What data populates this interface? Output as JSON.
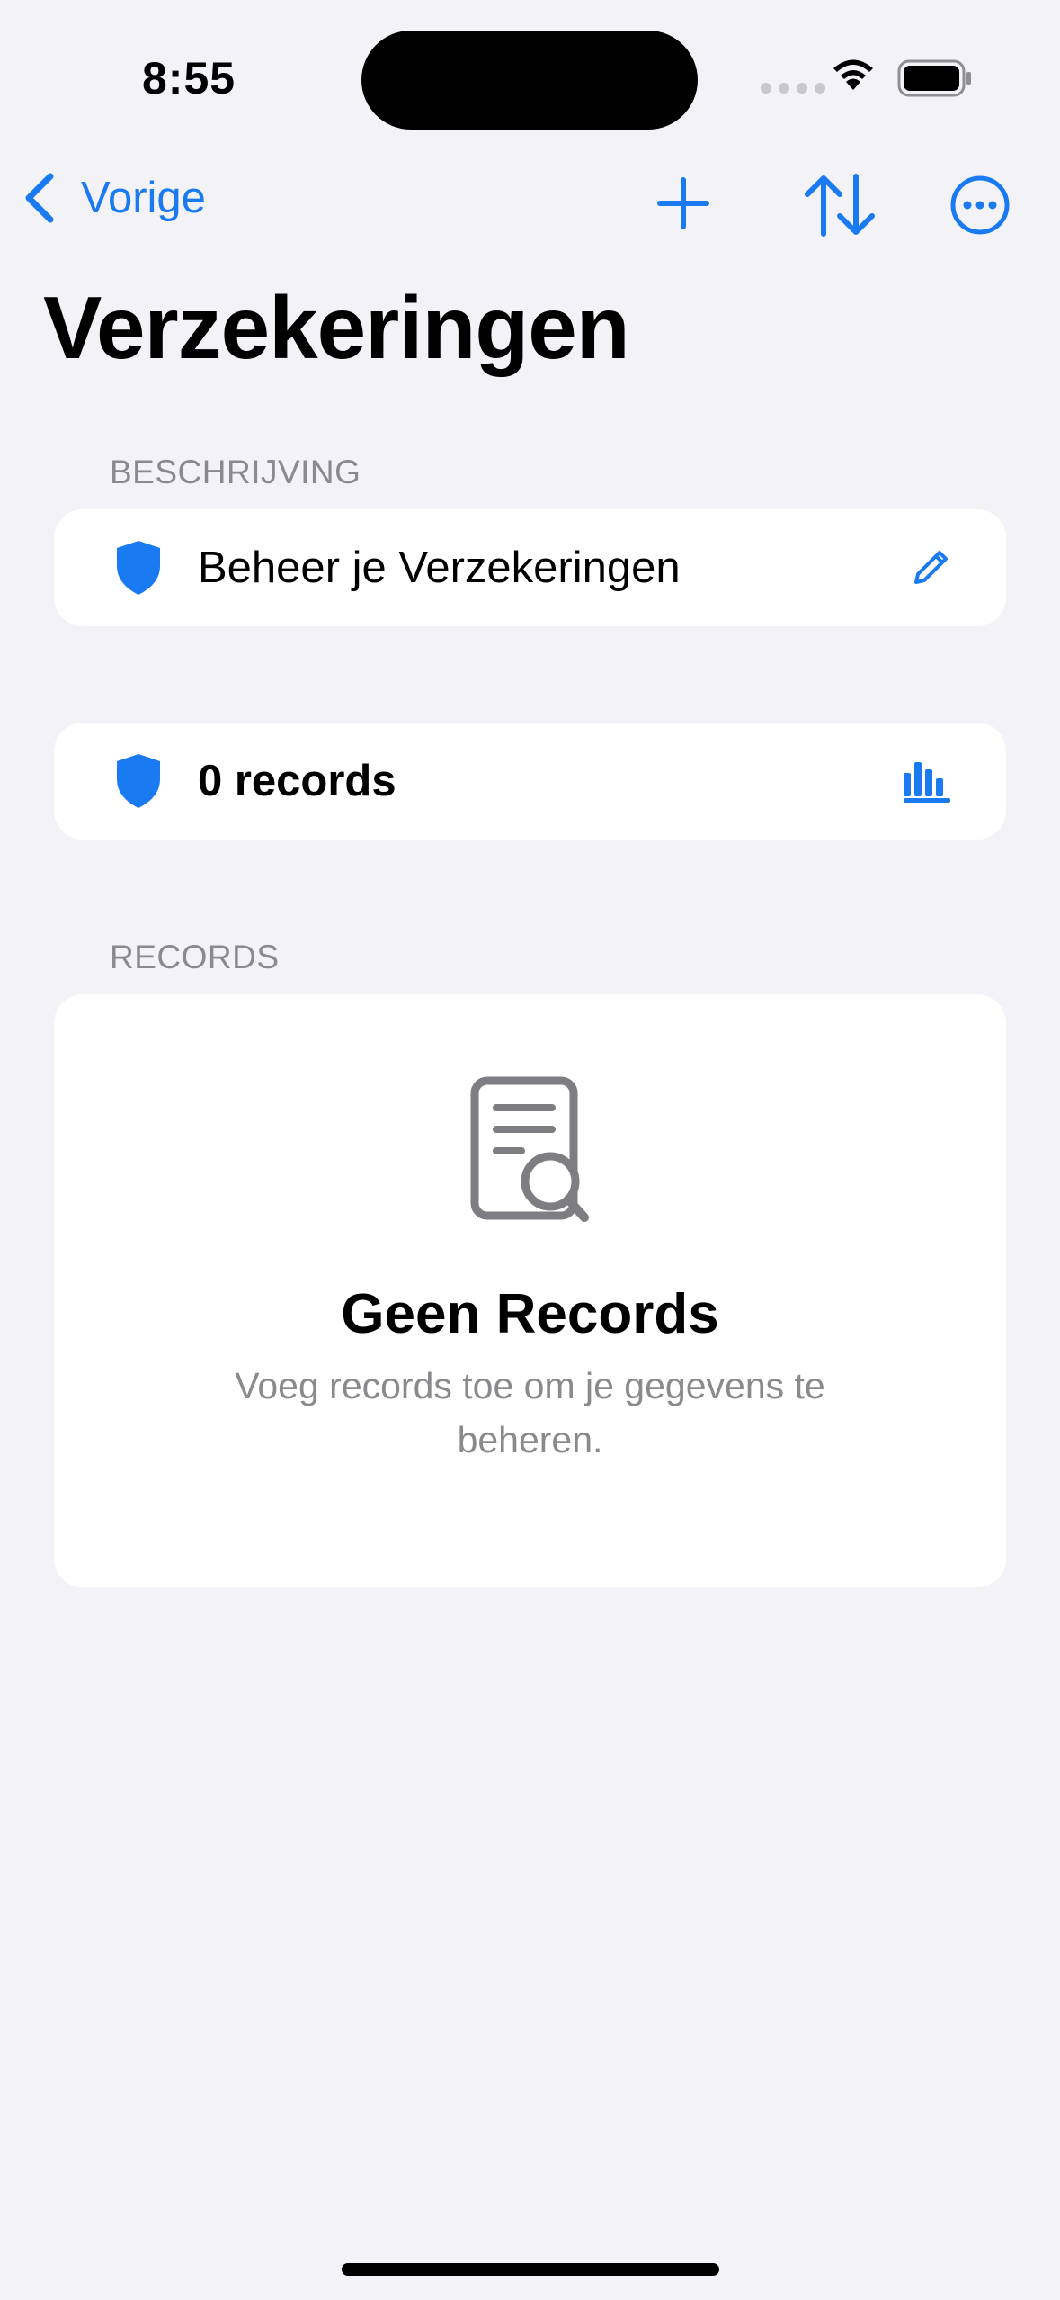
{
  "status_bar": {
    "time": "8:55"
  },
  "nav": {
    "back_label": "Vorige"
  },
  "page": {
    "title": "Verzekeringen"
  },
  "description_section": {
    "header": "BESCHRIJVING",
    "text": "Beheer je Verzekeringen"
  },
  "summary": {
    "count_label": "0 records"
  },
  "records_section": {
    "header": "RECORDS",
    "empty_title": "Geen Records",
    "empty_text": "Voeg records toe om je gegevens te beheren."
  },
  "colors": {
    "accent": "#1a7af2",
    "background": "#f2f2f7",
    "secondary_text": "#8a8a8e"
  },
  "icons": {
    "back": "chevron-left-icon",
    "add": "plus-icon",
    "sort": "sort-arrows-icon",
    "more": "ellipsis-circle-icon",
    "shield": "shield-icon",
    "edit": "pencil-icon",
    "chart": "bar-chart-icon",
    "empty": "document-search-icon"
  }
}
